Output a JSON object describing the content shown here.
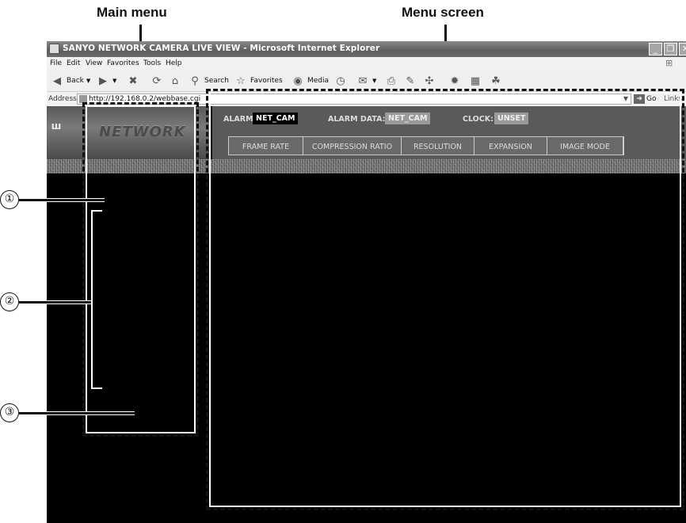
{
  "callouts": {
    "main_menu": "Main menu",
    "menu_screen": "Menu screen",
    "markers": [
      "①",
      "②",
      "③"
    ]
  },
  "window": {
    "title": "SANYO NETWORK CAMERA LIVE VIEW - Microsoft Internet Explorer",
    "controls": {
      "minimize": "_",
      "restore": "❐",
      "close": "✕"
    }
  },
  "menubar": {
    "items": [
      "File",
      "Edit",
      "View",
      "Favorites",
      "Tools",
      "Help"
    ]
  },
  "toolbar": {
    "back": "Back",
    "search": "Search",
    "favorites": "Favorites",
    "media": "Media"
  },
  "addressbar": {
    "label": "Address",
    "url": "http://192.168.0.2/webbase.cgi",
    "go": "Go",
    "links": "Links"
  },
  "page": {
    "logo_text": "NETWORK",
    "status": {
      "alarm_label": "ALARM:",
      "alarm_value": "NET_CAM",
      "alarm_data_label": "ALARM DATA:",
      "alarm_data_value": "NET_CAM",
      "clock_label": "CLOCK:",
      "clock_value": "UNSET"
    },
    "tabs": [
      "FRAME RATE",
      "COMPRESSION RATIO",
      "RESOLUTION",
      "EXPANSION",
      "IMAGE MODE"
    ]
  },
  "colors": {
    "titlebar": "#6a6a6a",
    "content_background": "#000000",
    "status_strip": "#5a5a5a"
  }
}
